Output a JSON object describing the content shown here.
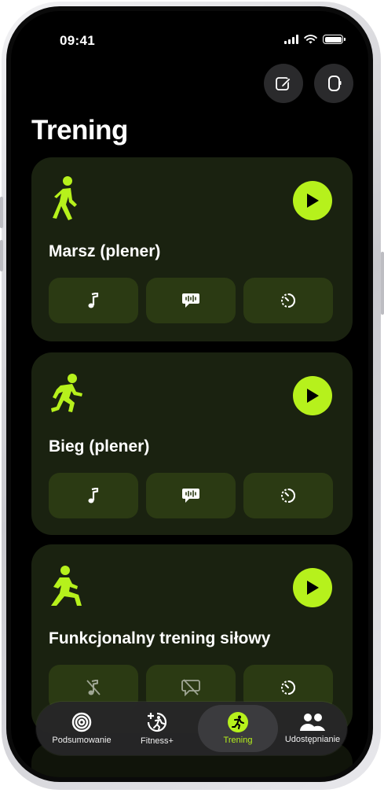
{
  "status_bar": {
    "time": "09:41"
  },
  "page": {
    "title": "Trening"
  },
  "workouts": [
    {
      "name": "Marsz (plener)",
      "icon": "walking-figure-icon",
      "chip_icons": [
        "music-note-icon",
        "voice-feedback-icon",
        "timer-icon"
      ]
    },
    {
      "name": "Bieg (plener)",
      "icon": "running-figure-icon",
      "chip_icons": [
        "music-note-icon",
        "voice-feedback-icon",
        "timer-icon"
      ]
    },
    {
      "name": "Funkcjonalny trening siłowy",
      "icon": "strength-figure-icon",
      "chip_icons": [
        "music-off-icon",
        "voice-feedback-off-icon",
        "timer-icon"
      ]
    }
  ],
  "tabbar": {
    "tabs": [
      {
        "label": "Podsumowanie",
        "icon": "activity-rings-icon"
      },
      {
        "label": "Fitness+",
        "icon": "fitness-plus-icon"
      },
      {
        "label": "Trening",
        "icon": "running-icon",
        "active": true
      },
      {
        "label": "Udostępnianie",
        "icon": "people-icon"
      }
    ]
  },
  "colors": {
    "accent": "#b6f11c",
    "card": "#1a2210",
    "chip": "#2b3a13",
    "background": "#000000"
  }
}
